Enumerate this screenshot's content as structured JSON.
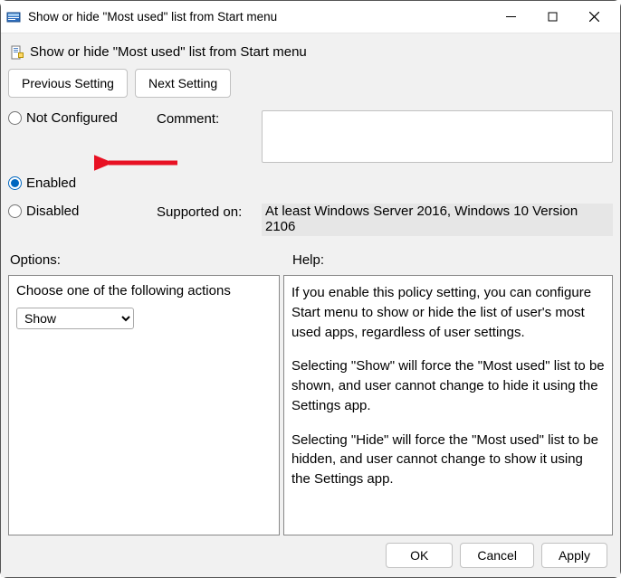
{
  "window": {
    "title": "Show or hide \"Most used\" list from Start menu"
  },
  "policy": {
    "title": "Show or hide \"Most used\" list from Start menu"
  },
  "nav": {
    "prev": "Previous Setting",
    "next": "Next Setting"
  },
  "state": {
    "not_configured": "Not Configured",
    "enabled": "Enabled",
    "disabled": "Disabled",
    "selected": "enabled"
  },
  "labels": {
    "comment": "Comment:",
    "supported": "Supported on:",
    "options": "Options:",
    "help": "Help:"
  },
  "comment": "",
  "supported_on": "At least Windows Server 2016, Windows 10 Version 2106",
  "options": {
    "prompt": "Choose one of the following actions",
    "value": "Show"
  },
  "help": {
    "p1": "If you enable this policy setting, you can configure Start menu to show or hide the list of user's most used apps, regardless of user settings.",
    "p2": "Selecting \"Show\" will force the \"Most used\" list to be shown, and user cannot change to hide it using the Settings app.",
    "p3": "Selecting \"Hide\" will force the \"Most used\" list to be hidden, and user cannot change to show it using the Settings app."
  },
  "footer": {
    "ok": "OK",
    "cancel": "Cancel",
    "apply": "Apply"
  }
}
